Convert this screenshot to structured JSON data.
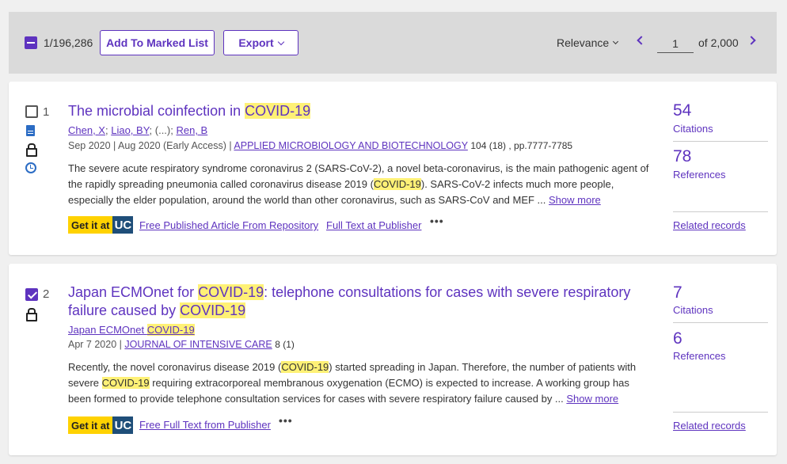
{
  "toolbar": {
    "count": "1/196,286",
    "mark_label": "Add To Marked List",
    "export_label": "Export",
    "sort_label": "Relevance",
    "page_value": "1",
    "page_of": "of 2,000"
  },
  "colors": {
    "accent": "#5e33bf",
    "highlight": "#fff176",
    "getit_yellow": "#ffd200",
    "uc_blue": "#1f4e79"
  },
  "results": [
    {
      "index": "1",
      "checked": false,
      "title_pre": "The microbial coinfection in ",
      "title_hl": "COVID-19",
      "authors": [
        "Chen, X",
        "Liao, BY",
        "Ren, B"
      ],
      "authors_sep": "; (...); ",
      "date": "Sep 2020 | Aug 2020 (Early Access) | ",
      "source": "APPLIED MICROBIOLOGY AND BIOTECHNOLOGY",
      "volume": "104 (18) , pp.7777-7785",
      "abstract_1": "The severe acute respiratory syndrome coronavirus 2 (SARS-CoV-2), a novel beta-coronavirus, is the main pathogenic agent of the rapidly spreading pneumonia called coronavirus disease 2019 (",
      "abstract_hl": "COVID-19",
      "abstract_2": "). SARS-CoV-2 infects much more people, especially the elder population, around the world than other coronavirus, such as SARS-CoV and MEF ... ",
      "show_more": "Show more",
      "getit": "Get it at",
      "uc": "UC",
      "link_1": "Free Published Article From Repository",
      "link_2": "Full Text at Publisher",
      "more": "•••",
      "citations": "54",
      "citations_label": "Citations",
      "references": "78",
      "references_label": "References",
      "related": "Related records"
    },
    {
      "index": "2",
      "checked": true,
      "title_a": "Japan ECMOnet for ",
      "title_hl1": "COVID-19",
      "title_b": ": telephone consultations for cases with severe respiratory failure caused by ",
      "title_hl2": "COVID-19",
      "author_group": "Japan ECMOnet ",
      "author_group_hl": "COVID-19",
      "date": "Apr 7 2020 | ",
      "source": "JOURNAL OF INTENSIVE CARE",
      "volume": "8 (1)",
      "abstract_1": "Recently, the novel coronavirus disease 2019 (",
      "abstract_hl1": "COVID-19",
      "abstract_2": ") started spreading in Japan. Therefore, the number of patients with severe ",
      "abstract_hl2": "COVID-19",
      "abstract_3": " requiring extracorporeal membranous oxygenation (ECMO) is expected to increase. A working group has been formed to provide telephone consultation services for cases with severe respiratory failure caused by  ... ",
      "show_more": "Show more",
      "getit": "Get it at",
      "uc": "UC",
      "link_1": "Free Full Text from Publisher",
      "more": "•••",
      "citations": "7",
      "citations_label": "Citations",
      "references": "6",
      "references_label": "References",
      "related": "Related records"
    }
  ]
}
